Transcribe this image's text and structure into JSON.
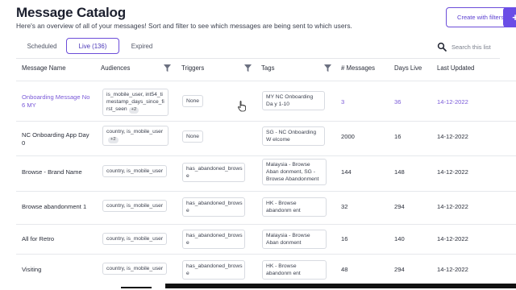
{
  "header": {
    "title": "Message Catalog",
    "subtitle": "Here's an overview of all of your messages! Sort and filter to see which messages are being sent to which users.",
    "create_filters_label": "Create with filters",
    "plus_label": "+"
  },
  "tabs": [
    {
      "label": "Scheduled"
    },
    {
      "label": "Live (136)"
    },
    {
      "label": "Expired"
    }
  ],
  "search": {
    "placeholder": "Search this list"
  },
  "columns": {
    "name": "Message Name",
    "audiences": "Audiences",
    "triggers": "Triggers",
    "tags": "Tags",
    "messages": "# Messages",
    "days": "Days Live",
    "updated": "Last Updated"
  },
  "rows": [
    {
      "name": "Onboarding Message No 6 MY",
      "audience": "is_mobile_user, int54_ti mestamp_days_since_fi rst_seen",
      "audience_badge": "+2",
      "trigger": "None",
      "tag": "MY NC Onboarding Da y 1-10",
      "messages": "3",
      "days": "36",
      "updated": "14-12-2022"
    },
    {
      "name": "NC Onboarding App Day 0",
      "audience": "country, is_mobile_user",
      "audience_badge": "+2",
      "trigger": "None",
      "tag": "SG - NC Onboarding W elcome",
      "messages": "2000",
      "days": "16",
      "updated": "14-12-2022"
    },
    {
      "name": "Browse - Brand Name",
      "audience": "country, is_mobile_user",
      "audience_badge": "",
      "trigger": "has_abandoned_brows e",
      "tag": "Malaysia - Browse Aban donment, SG - Browse Abandonment",
      "messages": "144",
      "days": "148",
      "updated": "14-12-2022"
    },
    {
      "name": "Browse abandonment 1",
      "audience": "country, is_mobile_user",
      "audience_badge": "",
      "trigger": "has_abandoned_brows e",
      "tag": "HK - Browse abandonm ent",
      "messages": "32",
      "days": "294",
      "updated": "14-12-2022"
    },
    {
      "name": "All for Retro",
      "audience": "country, is_mobile_user",
      "audience_badge": "",
      "trigger": "has_abandoned_brows e",
      "tag": "Malaysia - Browse Aban donment",
      "messages": "16",
      "days": "140",
      "updated": "14-12-2022"
    },
    {
      "name": "Visiting",
      "audience": "country, is_mobile_user",
      "audience_badge": "",
      "trigger": "has_abandoned_brows e",
      "tag": "HK - Browse abandonm ent",
      "messages": "48",
      "days": "294",
      "updated": "14-12-2022"
    }
  ],
  "colors": {
    "accent": "#6a4de6",
    "link": "#7a5ad8"
  }
}
